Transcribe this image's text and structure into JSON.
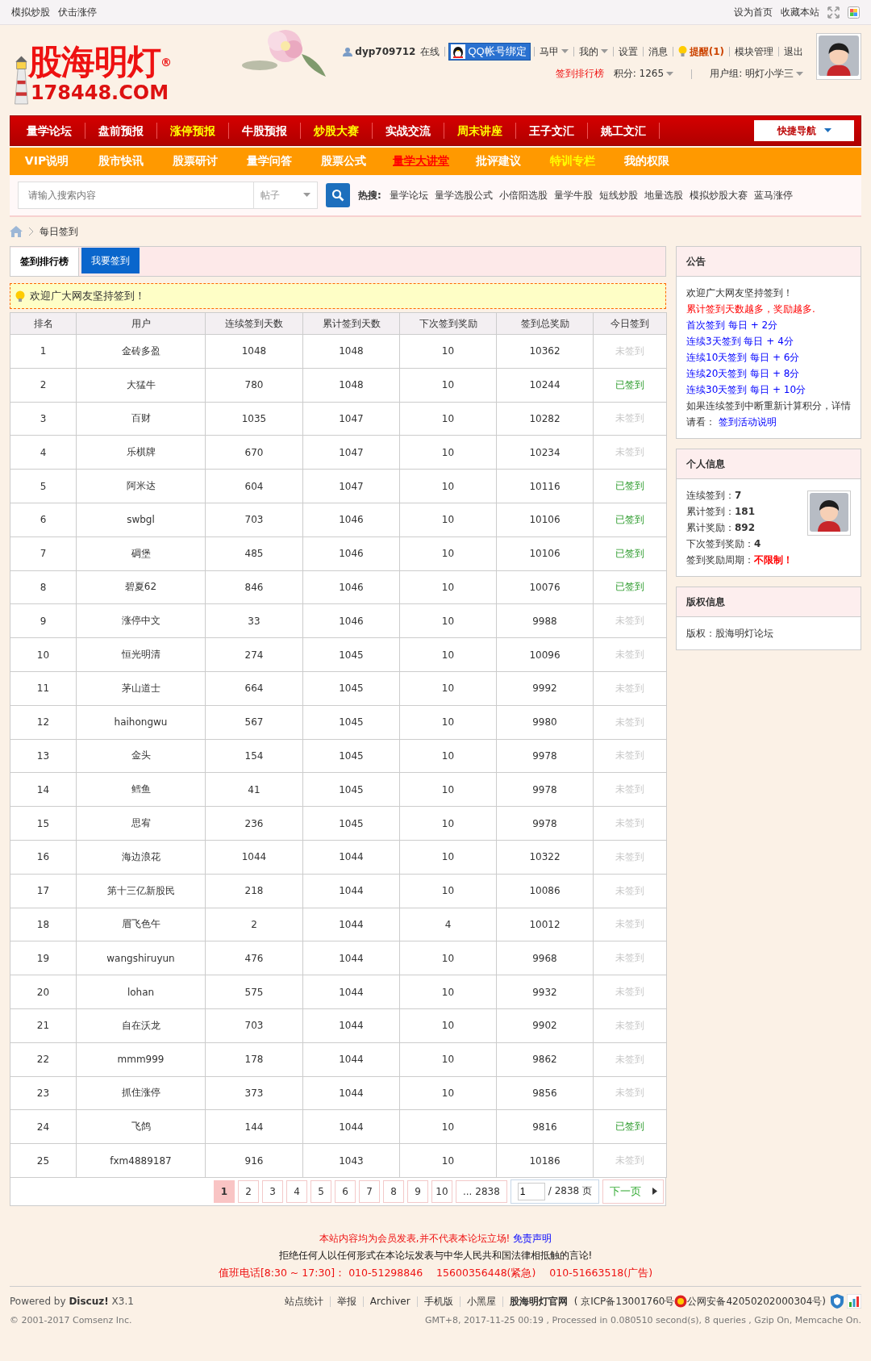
{
  "topbar": {
    "left": [
      "模拟炒股",
      "伏击涨停"
    ],
    "right": [
      "设为首页",
      "收藏本站"
    ]
  },
  "logo": {
    "name": "股海明灯",
    "mark": "®",
    "domain": "178448.COM"
  },
  "user_bar": {
    "username": "dyp709712",
    "status": "在线",
    "qq_button": "QQ帐号绑定",
    "menus": [
      {
        "label": "马甲",
        "dropdown": true
      },
      {
        "label": "我的",
        "dropdown": true
      },
      {
        "label": "设置",
        "dropdown": false
      },
      {
        "label": "消息",
        "dropdown": false
      }
    ],
    "alert": "提醒(1)",
    "links": [
      "模块管理",
      "退出"
    ],
    "ranking_link": "签到排行榜",
    "points": "积分: 1265",
    "group": "用户组: 明灯小学三"
  },
  "main_nav": [
    {
      "label": "量学论坛",
      "color": "#ffffff"
    },
    {
      "label": "盘前预报",
      "color": "#ffffff"
    },
    {
      "label": "涨停预报",
      "color": "#ffff00"
    },
    {
      "label": "牛股预报",
      "color": "#ffffff"
    },
    {
      "label": "炒股大赛",
      "color": "#ffff00"
    },
    {
      "label": "实战交流",
      "color": "#ffffff"
    },
    {
      "label": "周末讲座",
      "color": "#ffff00"
    },
    {
      "label": "王子文汇",
      "color": "#ffffff"
    },
    {
      "label": "姚工文汇",
      "color": "#ffffff"
    }
  ],
  "quick_nav": "快捷导航",
  "sub_nav": [
    {
      "label": "VIP说明",
      "color": "#ffffff",
      "selected": false
    },
    {
      "label": "股市快讯",
      "color": "#ffffff",
      "selected": false
    },
    {
      "label": "股票研讨",
      "color": "#ffffff",
      "selected": false
    },
    {
      "label": "量学问答",
      "color": "#ffffff",
      "selected": false
    },
    {
      "label": "股票公式",
      "color": "#ffffff",
      "selected": false
    },
    {
      "label": "量学大讲堂",
      "color": "#ff0000",
      "selected": true
    },
    {
      "label": "批评建议",
      "color": "#ffffff",
      "selected": false
    },
    {
      "label": "特训专栏",
      "color": "#ffff00",
      "selected": false
    },
    {
      "label": "我的权限",
      "color": "#ffffff",
      "selected": false
    }
  ],
  "search": {
    "placeholder": "请输入搜索内容",
    "scope": "帖子",
    "hot_label": "热搜:",
    "hot": [
      "量学论坛",
      "量学选股公式",
      "小倍阳选股",
      "量学牛股",
      "短线炒股",
      "地量选股",
      "模拟炒股大赛",
      "蓝马涨停"
    ]
  },
  "breadcrumb": [
    "每日签到"
  ],
  "tabs": [
    {
      "label": "签到排行榜",
      "selected": true
    }
  ],
  "action_button": "我要签到",
  "notice": "欢迎广大网友坚持签到！",
  "table": {
    "columns": [
      "排名",
      "用户",
      "连续签到天数",
      "累计签到天数",
      "下次签到奖励",
      "签到总奖励",
      "今日签到"
    ],
    "rows": [
      {
        "cells": [
          "1",
          "金砖多盈",
          "1048",
          "1048",
          "10",
          "10362"
        ],
        "today": "未签到",
        "signed": false
      },
      {
        "cells": [
          "2",
          "大猛牛",
          "780",
          "1048",
          "10",
          "10244"
        ],
        "today": "已签到",
        "signed": true
      },
      {
        "cells": [
          "3",
          "百财",
          "1035",
          "1047",
          "10",
          "10282"
        ],
        "today": "未签到",
        "signed": false
      },
      {
        "cells": [
          "4",
          "乐棋牌",
          "670",
          "1047",
          "10",
          "10234"
        ],
        "today": "未签到",
        "signed": false
      },
      {
        "cells": [
          "5",
          "阿米达",
          "604",
          "1047",
          "10",
          "10116"
        ],
        "today": "已签到",
        "signed": true
      },
      {
        "cells": [
          "6",
          "swbgl",
          "703",
          "1046",
          "10",
          "10106"
        ],
        "today": "已签到",
        "signed": true
      },
      {
        "cells": [
          "7",
          "碉堡",
          "485",
          "1046",
          "10",
          "10106"
        ],
        "today": "已签到",
        "signed": true
      },
      {
        "cells": [
          "8",
          "碧夏62",
          "846",
          "1046",
          "10",
          "10076"
        ],
        "today": "已签到",
        "signed": true
      },
      {
        "cells": [
          "9",
          "涨停中文",
          "33",
          "1046",
          "10",
          "9988"
        ],
        "today": "未签到",
        "signed": false
      },
      {
        "cells": [
          "10",
          "恒光明清",
          "274",
          "1045",
          "10",
          "10096"
        ],
        "today": "未签到",
        "signed": false
      },
      {
        "cells": [
          "11",
          "茅山道士",
          "664",
          "1045",
          "10",
          "9992"
        ],
        "today": "未签到",
        "signed": false
      },
      {
        "cells": [
          "12",
          "haihongwu",
          "567",
          "1045",
          "10",
          "9980"
        ],
        "today": "未签到",
        "signed": false
      },
      {
        "cells": [
          "13",
          "金头",
          "154",
          "1045",
          "10",
          "9978"
        ],
        "today": "未签到",
        "signed": false
      },
      {
        "cells": [
          "14",
          "鳕鱼",
          "41",
          "1045",
          "10",
          "9978"
        ],
        "today": "未签到",
        "signed": false
      },
      {
        "cells": [
          "15",
          "思宥",
          "236",
          "1045",
          "10",
          "9978"
        ],
        "today": "未签到",
        "signed": false
      },
      {
        "cells": [
          "16",
          "海边浪花",
          "1044",
          "1044",
          "10",
          "10322"
        ],
        "today": "未签到",
        "signed": false
      },
      {
        "cells": [
          "17",
          "第十三亿新股民",
          "218",
          "1044",
          "10",
          "10086"
        ],
        "today": "未签到",
        "signed": false
      },
      {
        "cells": [
          "18",
          "眉飞色午",
          "2",
          "1044",
          "4",
          "10012"
        ],
        "today": "未签到",
        "signed": false
      },
      {
        "cells": [
          "19",
          "wangshiruyun",
          "476",
          "1044",
          "10",
          "9968"
        ],
        "today": "未签到",
        "signed": false
      },
      {
        "cells": [
          "20",
          "lohan",
          "575",
          "1044",
          "10",
          "9932"
        ],
        "today": "未签到",
        "signed": false
      },
      {
        "cells": [
          "21",
          "自在沃龙",
          "703",
          "1044",
          "10",
          "9902"
        ],
        "today": "未签到",
        "signed": false
      },
      {
        "cells": [
          "22",
          "mmm999",
          "178",
          "1044",
          "10",
          "9862"
        ],
        "today": "未签到",
        "signed": false
      },
      {
        "cells": [
          "23",
          "抓住涨停",
          "373",
          "1044",
          "10",
          "9856"
        ],
        "today": "未签到",
        "signed": false
      },
      {
        "cells": [
          "24",
          "飞鸽",
          "144",
          "1044",
          "10",
          "9816"
        ],
        "today": "已签到",
        "signed": true
      },
      {
        "cells": [
          "25",
          "fxm4889187",
          "916",
          "1043",
          "10",
          "10186"
        ],
        "today": "未签到",
        "signed": false
      }
    ]
  },
  "pagination": {
    "pages": [
      {
        "label": "1",
        "selected": true
      },
      {
        "label": "2",
        "selected": false
      },
      {
        "label": "3",
        "selected": false
      },
      {
        "label": "4",
        "selected": false
      },
      {
        "label": "5",
        "selected": false
      },
      {
        "label": "6",
        "selected": false
      },
      {
        "label": "7",
        "selected": false
      },
      {
        "label": "8",
        "selected": false
      },
      {
        "label": "9",
        "selected": false
      },
      {
        "label": "10",
        "selected": false
      },
      {
        "label": "... 2838",
        "selected": false
      }
    ],
    "page_value": "1",
    "total": "/ 2838 页",
    "next": "下一页"
  },
  "announcement": {
    "title": "公告",
    "lines": [
      {
        "kind": "text",
        "text": "欢迎广大网友坚持签到！"
      },
      {
        "kind": "warning",
        "text": "累计签到天数越多，奖励越多."
      },
      {
        "kind": "link",
        "text": "首次签到 每日 + 2分"
      },
      {
        "kind": "link",
        "text": "连续3天签到 每日 + 4分"
      },
      {
        "kind": "link",
        "text": "连续10天签到 每日 + 6分"
      },
      {
        "kind": "link",
        "text": "连续20天签到 每日 + 8分"
      },
      {
        "kind": "link",
        "text": "连续30天签到 每日 + 10分"
      }
    ],
    "note": "如果连续签到中断重新计算积分，详情请看：",
    "note_link": "签到活动说明"
  },
  "personal": {
    "title": "个人信息",
    "stats": [
      {
        "label": "连续签到：",
        "value": "7",
        "emphasis": false
      },
      {
        "label": "累计签到：",
        "value": "181",
        "emphasis": false
      },
      {
        "label": "累计奖励：",
        "value": "892",
        "emphasis": false
      },
      {
        "label": "下次签到奖励：",
        "value": "4",
        "emphasis": false
      },
      {
        "label": "签到奖励周期：",
        "value": "不限制！",
        "emphasis": true
      }
    ]
  },
  "copyright": {
    "title": "版权信息",
    "text": "版权：股海明灯论坛"
  },
  "footer": {
    "disclaimer": "本站内容均为会员发表,并不代表本论坛立场!",
    "disclaimer_link": "免责声明",
    "warning": "拒绝任何人以任何形式在本论坛发表与中华人民共和国法律相抵触的言论!",
    "hotline": "值班电话[8:30 ~ 17:30]： 010-51298846　 15600356448(紧急)　 010-51663518(广告)",
    "powered": "Powered by",
    "product": "Discuz!",
    "version": "X3.1",
    "company": "© 2001-2017 Comsenz Inc.",
    "links": [
      "站点统计",
      "举报",
      "Archiver",
      "手机版",
      "小黑屋"
    ],
    "site": "股海明灯官网",
    "icp": "( 京ICP备13001760号",
    "police": "公网安备42050202000304号)",
    "stats": "GMT+8, 2017-11-25 00:19 , Processed in 0.080510 second(s), 8 queries , Gzip On, Memcache On."
  }
}
